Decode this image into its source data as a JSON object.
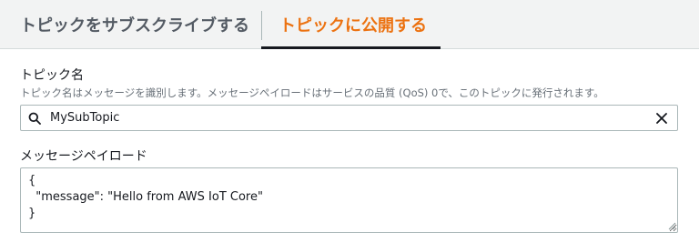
{
  "tabs": {
    "subscribe_label": "トピックをサブスクライブする",
    "publish_label": "トピックに公開する",
    "active_tab": "publish"
  },
  "topic": {
    "label": "トピック名",
    "description": "トピック名はメッセージを識別します。メッセージペイロードはサービスの品質 (QoS) 0で、このトピックに発行されます。",
    "value": "MySubTopic",
    "search_icon": "search-icon",
    "clear_icon": "close-icon"
  },
  "payload": {
    "label": "メッセージペイロード",
    "value": "{\n  \"message\": \"Hello from AWS IoT Core\"\n}"
  },
  "colors": {
    "accent": "#ec7211",
    "tab_bar_bg": "#f2f3f3",
    "border": "#aab7b8"
  }
}
